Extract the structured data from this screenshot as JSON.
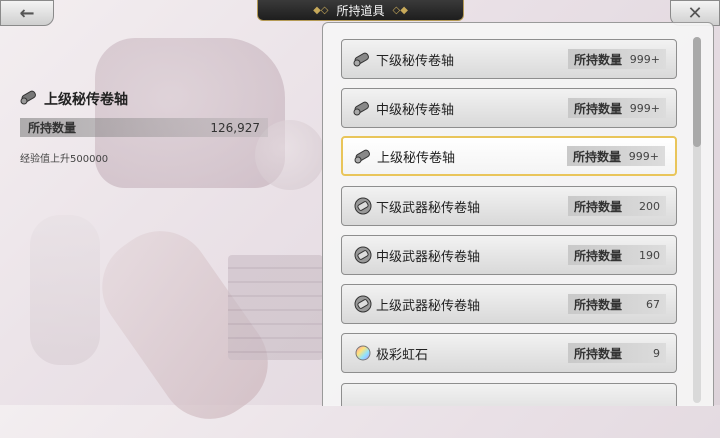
{
  "header": {
    "back_icon": "arrow-left-icon",
    "title": "所持道具",
    "close_icon": "close-icon"
  },
  "detail": {
    "name": "上级秘传卷轴",
    "icon": "scroll-icon",
    "count_label": "所持数量",
    "count_value": "126,927",
    "description": "经验值上升500000"
  },
  "items": [
    {
      "name": "下级秘传卷轴",
      "icon": "scroll-icon",
      "count_label": "所持数量",
      "count": "999+",
      "selected": false
    },
    {
      "name": "中级秘传卷轴",
      "icon": "scroll-icon",
      "count_label": "所持数量",
      "count": "999+",
      "selected": false
    },
    {
      "name": "上级秘传卷轴",
      "icon": "scroll-icon",
      "count_label": "所持数量",
      "count": "999+",
      "selected": true
    },
    {
      "name": "下级武器秘传卷轴",
      "icon": "weapon-scroll-icon",
      "count_label": "所持数量",
      "count": "200",
      "selected": false
    },
    {
      "name": "中级武器秘传卷轴",
      "icon": "weapon-scroll-icon",
      "count_label": "所持数量",
      "count": "190",
      "selected": false
    },
    {
      "name": "上级武器秘传卷轴",
      "icon": "weapon-scroll-icon",
      "count_label": "所持数量",
      "count": "67",
      "selected": false
    },
    {
      "name": "极彩虹石",
      "icon": "rainbow-gem-icon",
      "count_label": "所持数量",
      "count": "9",
      "selected": false
    }
  ],
  "colors": {
    "selected_border": "#e9c55a",
    "title_bar": "#1e1e1e"
  }
}
